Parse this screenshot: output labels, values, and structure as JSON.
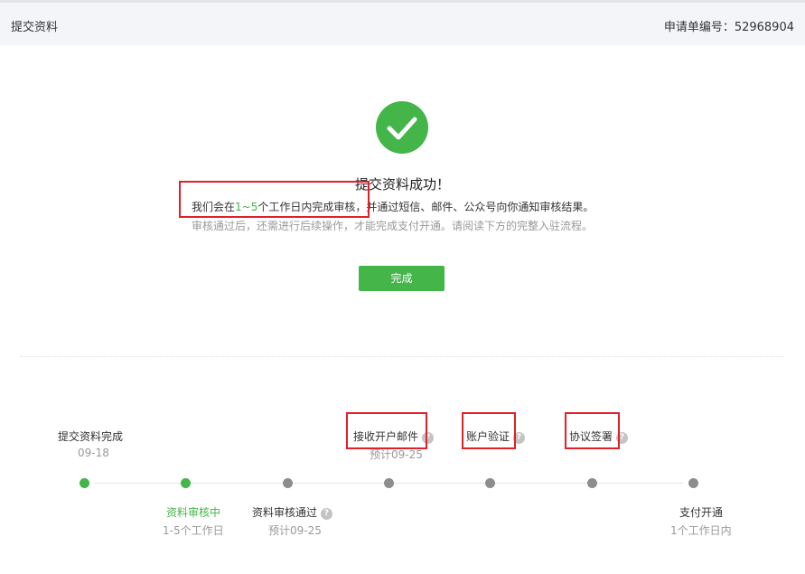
{
  "header": {
    "title": "提交资料",
    "application_number_label": "申请单编号：52968904"
  },
  "result": {
    "title": "提交资料成功！",
    "line1_prefix": "我们会在",
    "line1_highlight": "1~5",
    "line1_middle": "个工作日内完成审核",
    "line1_suffix": "，并通过短信、邮件、公众号向你通知审核结果。",
    "line2": "审核通过后，还需进行后续操作，才能完成支付开通。请阅读下方的完整入驻流程。",
    "done_button": "完成"
  },
  "colors": {
    "accent": "#44b549",
    "pending": "#8d8d8d",
    "highlight_box": "#e0202a"
  },
  "timeline": {
    "steps": [
      {
        "label": "提交资料完成",
        "sub": "09-18",
        "status": "done"
      },
      {
        "label": "资料审核中",
        "sub": "1-5个工作日",
        "status": "current"
      },
      {
        "label": "资料审核通过",
        "sub": "预计09-25",
        "status": "pending",
        "help": "?"
      },
      {
        "label": "接收开户邮件",
        "sub": "预计09-25",
        "status": "pending",
        "help": "?"
      },
      {
        "label": "账户验证",
        "sub": "",
        "status": "pending",
        "help": "?"
      },
      {
        "label": "协议签署",
        "sub": "",
        "status": "pending",
        "help": "?"
      },
      {
        "label": "支付开通",
        "sub": "1个工作日内",
        "status": "pending"
      }
    ]
  }
}
